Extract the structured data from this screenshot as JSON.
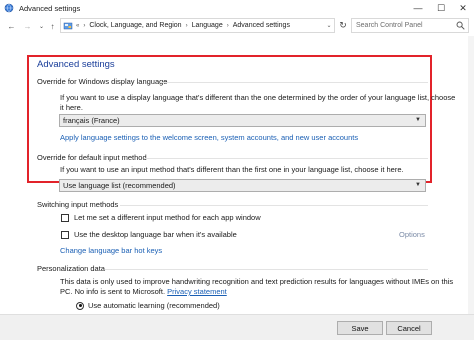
{
  "window": {
    "title": "Advanced settings",
    "controls": {
      "minimize": "—",
      "maximize": "☐",
      "close": "✕"
    }
  },
  "addressbar": {
    "back": "←",
    "forward": "→",
    "recent": "⌄",
    "up": "↑",
    "overflow": "«",
    "breadcrumbs": [
      "Clock, Language, and Region",
      "Language",
      "Advanced settings"
    ],
    "separator": "›",
    "refresh": "↻",
    "search_placeholder": "Search Control Panel"
  },
  "page": {
    "title": "Advanced settings",
    "accent_color": "#1a3e9a",
    "highlight_color": "#e2232a"
  },
  "display_language": {
    "heading": "Override for Windows display language",
    "description_line1": "If you want to use a display language that's different than the one determined by the order of your language list, choose",
    "description_line2": "it here.",
    "selected": "français (France)",
    "link": "Apply language settings to the welcome screen, system accounts, and new user accounts"
  },
  "input_method": {
    "heading": "Override for default input method",
    "description": "If you want to use an input method that's different than the first one in your language list, choose it here.",
    "selected": "Use language list (recommended)"
  },
  "switching": {
    "heading": "Switching input methods",
    "checkbox1": "Let me set a different input method for each app window",
    "checkbox2": "Use the desktop language bar when it's available",
    "options_link": "Options",
    "hotkeys_link": "Change language bar hot keys"
  },
  "personalization": {
    "heading": "Personalization data",
    "description_line1": "This data is only used to improve handwriting recognition and text prediction results for languages without IMEs on this",
    "description_line2_text": "PC. No info is sent to Microsoft.",
    "privacy_link": "Privacy statement",
    "radio_selected": "Use automatic learning (recommended)"
  },
  "footer": {
    "save": "Save",
    "cancel": "Cancel"
  }
}
